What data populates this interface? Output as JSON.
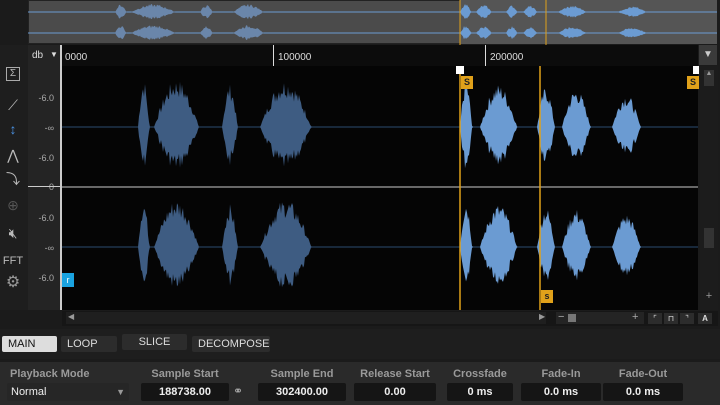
{
  "ruler": {
    "labels": [
      "0000",
      "100000",
      "200000"
    ]
  },
  "db_scale": {
    "unit_label": "db",
    "ticks": [
      "-6.0",
      "-∞",
      "-6.0",
      "0",
      "-6.0",
      "-∞",
      "-6.0"
    ]
  },
  "toolbar": {
    "fft_label": "FFT",
    "sum_label": "Σ"
  },
  "markers": {
    "slice_label": "S",
    "slice_label_lower": "s",
    "region_label": "r"
  },
  "tabs": [
    {
      "label": "MAIN",
      "active": true
    },
    {
      "label": "LOOP"
    },
    {
      "label": "SLICE"
    },
    {
      "label": "DECOMPOSE"
    }
  ],
  "params": {
    "playback_mode": {
      "label": "Playback Mode",
      "value": "Normal"
    },
    "sample_start": {
      "label": "Sample Start",
      "value": "188738.00"
    },
    "sample_end": {
      "label": "Sample End",
      "value": "302400.00"
    },
    "release_start": {
      "label": "Release Start",
      "value": "0.00"
    },
    "crossfade": {
      "label": "Crossfade",
      "value": "0 ms"
    },
    "fade_in": {
      "label": "Fade-In",
      "value": "0.0 ms"
    },
    "fade_out": {
      "label": "Fade-Out",
      "value": "0.0 ms"
    }
  },
  "colors": {
    "wave_dim": "#3e5c82",
    "wave_active": "#6b9bd2",
    "marker": "#e0a11a",
    "accent": "#1aa3e0"
  }
}
